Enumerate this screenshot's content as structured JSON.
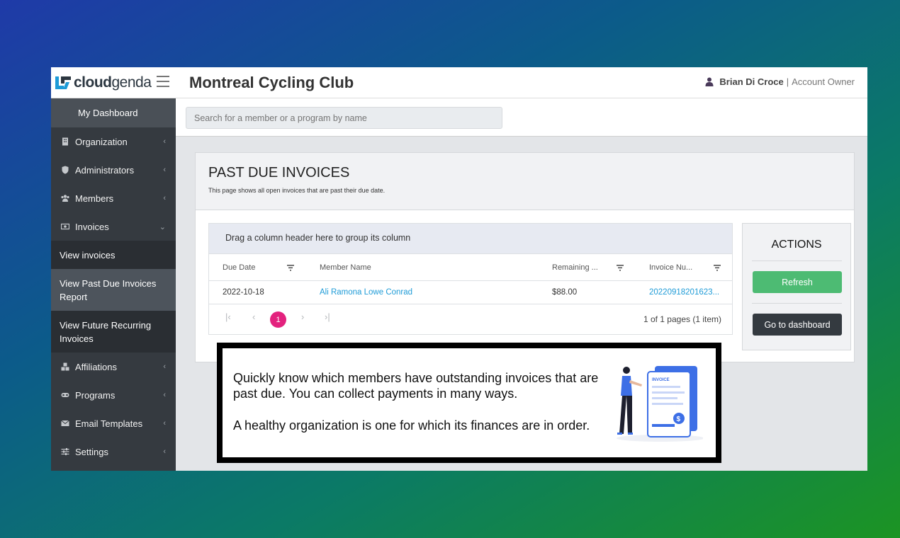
{
  "header": {
    "logo_part1": "cloud",
    "logo_part2": "genda",
    "club_name": "Montreal Cycling Club",
    "user_name": "Brian Di Croce",
    "user_separator": "|",
    "user_role": "Account Owner"
  },
  "search": {
    "placeholder": "Search for a member or a program by name"
  },
  "sidebar": {
    "dashboard": "My Dashboard",
    "items": [
      {
        "label": "Organization",
        "icon": "building-icon"
      },
      {
        "label": "Administrators",
        "icon": "shield-icon"
      },
      {
        "label": "Members",
        "icon": "users-icon"
      },
      {
        "label": "Invoices",
        "icon": "invoice-icon"
      }
    ],
    "invoice_sub": [
      {
        "label": "View invoices"
      },
      {
        "label": "View Past Due Invoices Report"
      },
      {
        "label": "View Future Recurring Invoices"
      }
    ],
    "items_bottom": [
      {
        "label": "Affiliations",
        "icon": "affiliations-icon"
      },
      {
        "label": "Programs",
        "icon": "programs-icon"
      },
      {
        "label": "Email Templates",
        "icon": "envelope-icon"
      },
      {
        "label": "Settings",
        "icon": "sliders-icon"
      }
    ]
  },
  "page": {
    "title": "PAST DUE INVOICES",
    "subtitle": "This page shows all open invoices that are past their due date."
  },
  "grid": {
    "group_hint": "Drag a column header here to group its column",
    "columns": [
      "Due Date",
      "Member Name",
      "Remaining ...",
      "Invoice Nu..."
    ],
    "rows": [
      {
        "due_date": "2022-10-18",
        "member": "Ali Ramona Lowe Conrad",
        "remaining": "$88.00",
        "invoice": "20220918201623..."
      }
    ],
    "pager": {
      "current_page": "1",
      "info": "1 of 1 pages (1 item)"
    }
  },
  "actions": {
    "title": "ACTIONS",
    "refresh": "Refresh",
    "dashboard": "Go to dashboard"
  },
  "promo": {
    "line1": "Quickly know which members have outstanding invoices that are past due. You can collect payments in many ways.",
    "line2": "A healthy organization is one for which its finances are in order.",
    "illus_label": "INVOICE"
  },
  "colors": {
    "accent_pink": "#e3227e",
    "link_blue": "#1e9bd7",
    "refresh_green": "#4dbb73",
    "sidebar_bg": "#353a40"
  }
}
